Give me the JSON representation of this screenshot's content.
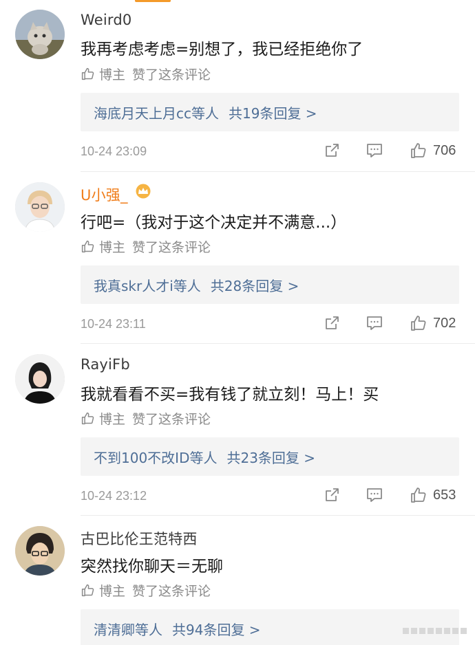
{
  "comments": [
    {
      "username": "Weird0",
      "text": "我再考虑考虑=别想了，我已经拒绝你了",
      "liked_by_label": "博主",
      "liked_by_suffix": "赞了这条评论",
      "reply_users": "海底月天上月cc等人",
      "reply_count": "共19条回复 >",
      "timestamp": "10-24 23:09",
      "likes": "706",
      "avatar_icon": "cat-avatar"
    },
    {
      "username": "U小强_",
      "text": "行吧=（我对于这个决定并不满意...）",
      "liked_by_label": "博主",
      "liked_by_suffix": "赞了这条评论",
      "reply_users": "我真skr人才i等人",
      "reply_count": "共28条回复 >",
      "timestamp": "10-24 23:11",
      "likes": "702",
      "avatar_icon": "boy-glasses-avatar",
      "badge_icon": "crown-icon"
    },
    {
      "username": "RayiFb",
      "text": "我就看看不买=我有钱了就立刻！马上！买",
      "liked_by_label": "博主",
      "liked_by_suffix": "赞了这条评论",
      "reply_users": "不到100不改ID等人",
      "reply_count": "共23条回复 >",
      "timestamp": "10-24 23:12",
      "likes": "653",
      "avatar_icon": "girl-avatar"
    },
    {
      "username": "古巴比伦王范特西",
      "text": "突然找你聊天＝无聊",
      "liked_by_label": "博主",
      "liked_by_suffix": "赞了这条评论",
      "reply_users": "清清卿等人",
      "reply_count": "共94条回复 >",
      "avatar_icon": "anime-glasses-avatar"
    }
  ],
  "colors": {
    "link": "#4e6e96",
    "vip_name": "#f07d1a",
    "secondary_text": "#8a8a8a",
    "reply_bg": "#f4f4f4"
  }
}
